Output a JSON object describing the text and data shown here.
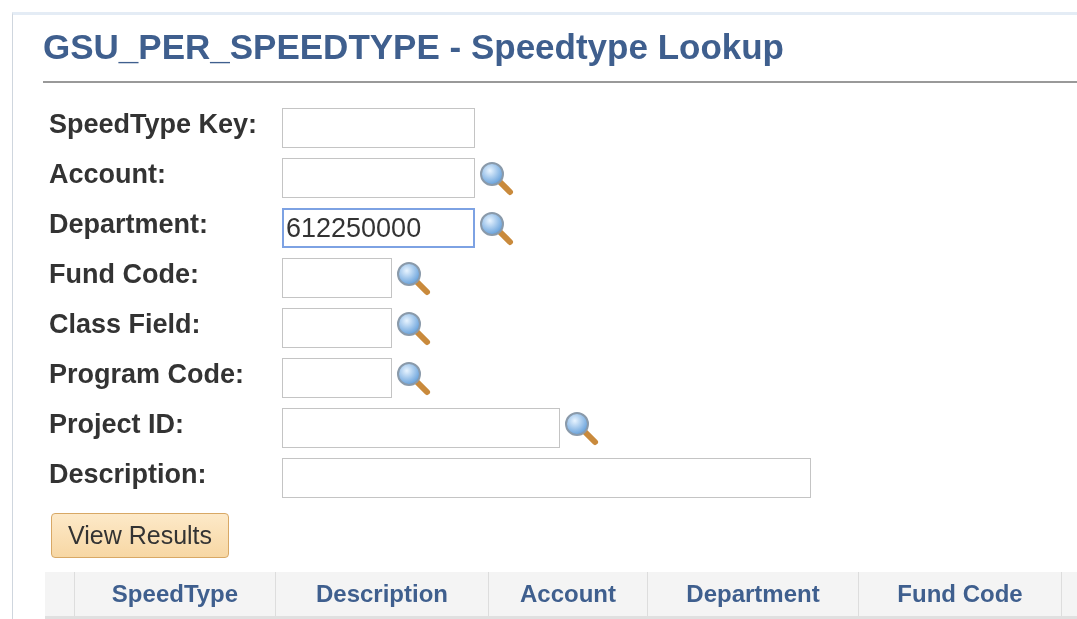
{
  "title": "GSU_PER_SPEEDTYPE - Speedtype Lookup",
  "fields": [
    {
      "label": "SpeedType Key:",
      "lookup": false,
      "focused": false
    },
    {
      "label": "Account:",
      "lookup": true,
      "focused": false
    },
    {
      "label": "Department:",
      "value": "612250000",
      "lookup": true,
      "focused": true
    },
    {
      "label": "Fund Code:",
      "lookup": true,
      "focused": false
    },
    {
      "label": "Class Field:",
      "lookup": true,
      "focused": false
    },
    {
      "label": "Program Code:",
      "lookup": true,
      "focused": false
    },
    {
      "label": "Project ID:",
      "lookup": true,
      "focused": false
    },
    {
      "label": "Description:",
      "lookup": false,
      "focused": false
    }
  ],
  "button": "View Results",
  "table": {
    "columns": [
      "SpeedType",
      "Description",
      "Account",
      "Department",
      "Fund Code"
    ]
  }
}
